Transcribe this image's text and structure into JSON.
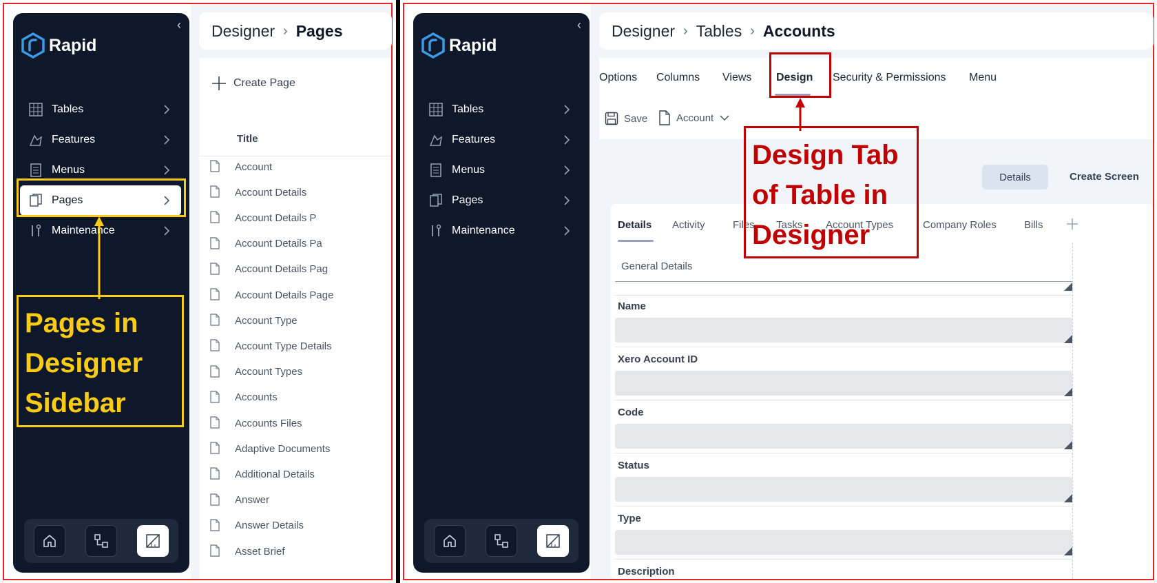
{
  "left": {
    "logo_text": "Rapid",
    "nav": [
      {
        "label": "Tables",
        "icon": "table-icon"
      },
      {
        "label": "Features",
        "icon": "features-icon"
      },
      {
        "label": "Menus",
        "icon": "menu-icon"
      },
      {
        "label": "Pages",
        "icon": "pages-icon"
      },
      {
        "label": "Maintenance",
        "icon": "wrench-icon"
      }
    ],
    "breadcrumb": {
      "root": "Designer",
      "current": "Pages"
    },
    "create_label": "Create Page",
    "column_header": "Title",
    "rows": [
      "Account",
      "Account Details",
      "Account Details P",
      "Account Details Pa",
      "Account Details Pag",
      "Account Details Page",
      "Account Type",
      "Account Type Details",
      "Account Types",
      "Accounts",
      "Accounts Files",
      "Adaptive Documents",
      "Additional Details",
      "Answer",
      "Answer Details",
      "Asset Brief"
    ],
    "annotation": [
      "Pages in",
      "Designer",
      "Sidebar"
    ]
  },
  "right": {
    "logo_text": "Rapid",
    "nav": [
      {
        "label": "Tables",
        "icon": "table-icon"
      },
      {
        "label": "Features",
        "icon": "features-icon"
      },
      {
        "label": "Menus",
        "icon": "menu-icon"
      },
      {
        "label": "Pages",
        "icon": "pages-icon"
      },
      {
        "label": "Maintenance",
        "icon": "wrench-icon"
      }
    ],
    "breadcrumb": {
      "root": "Designer",
      "mid": "Tables",
      "current": "Accounts"
    },
    "tabs": [
      "Options",
      "Columns",
      "Views",
      "Design",
      "Security & Permissions",
      "Menu"
    ],
    "toolbar": {
      "save": "Save",
      "page": "Account"
    },
    "buttons": {
      "details": "Details",
      "create_screen": "Create Screen"
    },
    "sub_tabs": [
      "Details",
      "Activity",
      "Files",
      "Tasks",
      "Account Types",
      "Company Roles",
      "Bills"
    ],
    "section_title": "General Details",
    "fields": [
      "Name",
      "Xero Account ID",
      "Code",
      "Status",
      "Type",
      "Description"
    ],
    "annotation": [
      "Design Tab",
      "of Table in",
      "Designer"
    ]
  },
  "colors": {
    "sidebar": "#0f172a",
    "yellow": "#facc15",
    "red": "#c00000"
  }
}
